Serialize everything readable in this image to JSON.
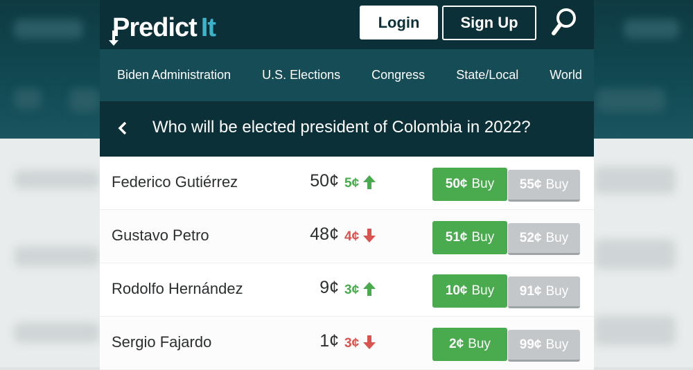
{
  "header": {
    "logo_main": "Predict",
    "logo_accent": "It",
    "login_label": "Login",
    "signup_label": "Sign Up"
  },
  "nav": [
    "Biden Administration",
    "U.S. Elections",
    "Congress",
    "State/Local",
    "World"
  ],
  "market": {
    "title": "Who will be elected president of Colombia in 2022?"
  },
  "contracts": [
    {
      "name": "Federico Gutiérrez",
      "price": "50¢",
      "change": "5¢",
      "direction": "up",
      "buy_yes": "50¢",
      "buy_no": "55¢",
      "buy_label": "Buy"
    },
    {
      "name": "Gustavo Petro",
      "price": "48¢",
      "change": "4¢",
      "direction": "down",
      "buy_yes": "51¢",
      "buy_no": "52¢",
      "buy_label": "Buy"
    },
    {
      "name": "Rodolfo Hernández",
      "price": "9¢",
      "change": "3¢",
      "direction": "up",
      "buy_yes": "10¢",
      "buy_no": "91¢",
      "buy_label": "Buy"
    },
    {
      "name": "Sergio Fajardo",
      "price": "1¢",
      "change": "3¢",
      "direction": "down",
      "buy_yes": "2¢",
      "buy_no": "99¢",
      "buy_label": "Buy"
    }
  ],
  "colors": {
    "header_bg": "#0c3038",
    "nav_bg": "#164c56",
    "yes_green": "#4aaa4e",
    "no_gray": "#c3c7c9",
    "up": "#4aaa4e",
    "down": "#d9534f",
    "accent": "#3bb3c8"
  }
}
